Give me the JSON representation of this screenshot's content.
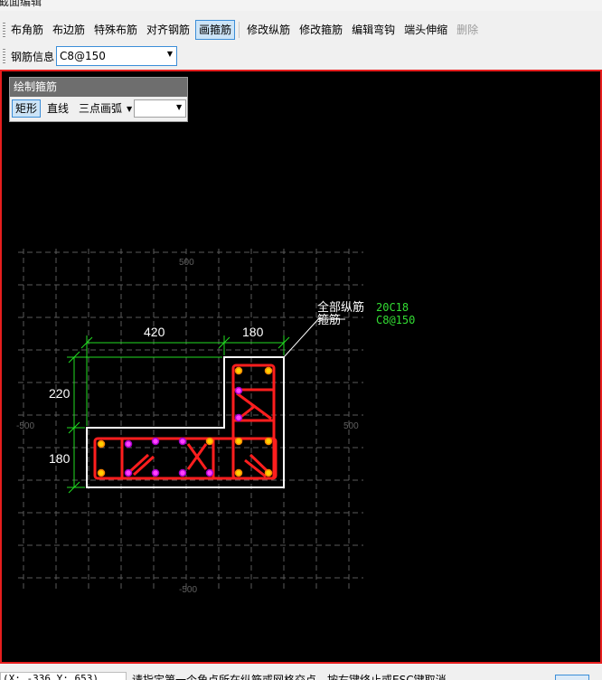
{
  "window": {
    "title": "截面编辑"
  },
  "toolbar": {
    "buttons": [
      {
        "label": "布角筋",
        "state": "normal"
      },
      {
        "label": "布边筋",
        "state": "normal"
      },
      {
        "label": "特殊布筋",
        "state": "normal"
      },
      {
        "label": "对齐钢筋",
        "state": "normal"
      },
      {
        "label": "画箍筋",
        "state": "active"
      },
      {
        "label": "修改纵筋",
        "state": "normal"
      },
      {
        "label": "修改箍筋",
        "state": "normal"
      },
      {
        "label": "编辑弯钩",
        "state": "normal"
      },
      {
        "label": "端头伸缩",
        "state": "normal"
      },
      {
        "label": "删除",
        "state": "disabled"
      }
    ]
  },
  "rebar_info": {
    "label": "钢筋信息",
    "value": "C8@150"
  },
  "draw_panel": {
    "title": "绘制箍筋",
    "modes": [
      "矩形",
      "直线",
      "三点画弧"
    ],
    "active_mode": "矩形",
    "combo_value": ""
  },
  "drawing": {
    "dimensions": {
      "top_left": "420",
      "top_right": "180",
      "left_upper": "220",
      "left_lower": "180"
    },
    "axis_labels": {
      "top": "500",
      "left": "-500",
      "right": "500",
      "bottom": "-500"
    },
    "legend": {
      "main_label": "全部纵筋",
      "main_value": "20C18",
      "stirrup_label": "箍筋",
      "stirrup_value": "C8@150"
    },
    "colors": {
      "background": "#000000",
      "outline": "#ffffff",
      "stirrup": "#ff1e1e",
      "dimension": "#22dd22",
      "grid": "#5a5a5a"
    }
  },
  "status": {
    "coords": "(X: -336 Y: 653)",
    "prompt": "请指定第一个角点所在纵筋或网格交点，按右键终止或ESC键取消"
  }
}
